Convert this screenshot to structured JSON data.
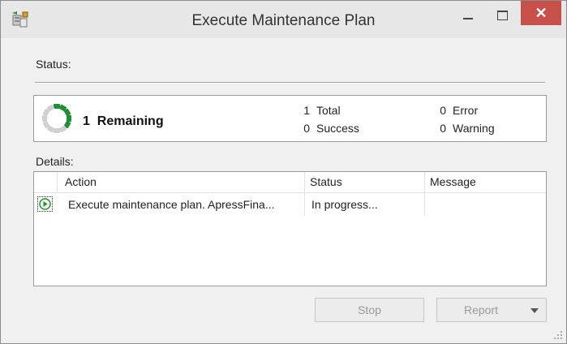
{
  "window": {
    "title": "Execute Maintenance Plan",
    "close_glyph": "✕",
    "icons": [
      "app-icon",
      "minimize-icon",
      "maximize-icon",
      "close-icon"
    ]
  },
  "status": {
    "label": "Status:",
    "remaining_count": "1",
    "remaining_label": "Remaining",
    "total_count": "1",
    "total_label": "Total",
    "success_count": "0",
    "success_label": "Success",
    "error_count": "0",
    "error_label": "Error",
    "warning_count": "0",
    "warning_label": "Warning",
    "spinner_colors": [
      "#1f8f36",
      "#d0d0d0"
    ]
  },
  "details": {
    "label": "Details:",
    "columns": [
      "Action",
      "Status",
      "Message"
    ],
    "rows": [
      {
        "icon": "in-progress-play-icon",
        "action": "Execute maintenance plan. ApressFina...",
        "status": "In progress...",
        "message": ""
      }
    ]
  },
  "buttons": {
    "stop": "Stop",
    "report": "Report"
  },
  "colors": {
    "close_button": "#c7504b",
    "progress_green": "#1f8f36",
    "disabled_text": "#9a9a9a"
  }
}
